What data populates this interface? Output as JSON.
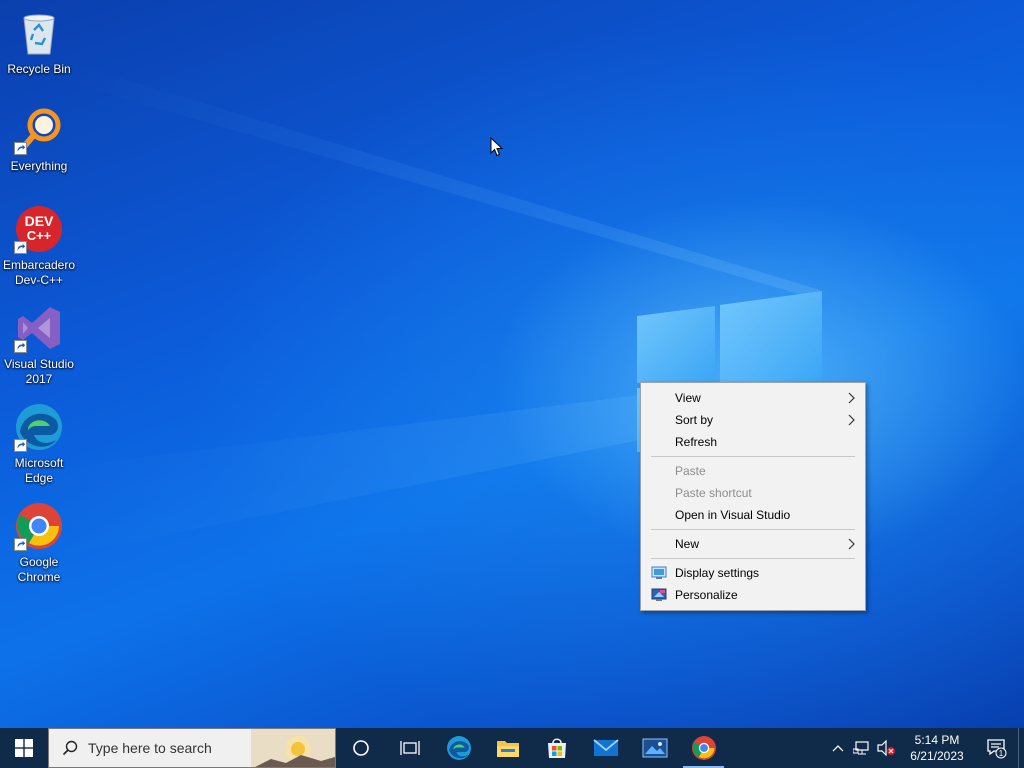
{
  "desktop_icons": [
    {
      "label": "Recycle Bin",
      "icon": "recycle-bin-icon",
      "shortcut": false
    },
    {
      "label": "Everything",
      "icon": "everything-search-icon",
      "shortcut": true
    },
    {
      "label": "Embarcadero\nDev-C++",
      "icon": "devcpp-icon",
      "icon_text": "DEV\nC++",
      "shortcut": true
    },
    {
      "label": "Visual Studio\n2017",
      "icon": "visual-studio-icon",
      "shortcut": true
    },
    {
      "label": "Microsoft\nEdge",
      "icon": "edge-icon",
      "shortcut": true
    },
    {
      "label": "Google\nChrome",
      "icon": "chrome-icon",
      "shortcut": true
    }
  ],
  "context_menu": {
    "items": [
      {
        "label": "View",
        "submenu": true,
        "disabled": false
      },
      {
        "label": "Sort by",
        "submenu": true,
        "disabled": false
      },
      {
        "label": "Refresh",
        "submenu": false,
        "disabled": false
      },
      {
        "separator": true
      },
      {
        "label": "Paste",
        "submenu": false,
        "disabled": true
      },
      {
        "label": "Paste shortcut",
        "submenu": false,
        "disabled": true
      },
      {
        "label": "Open in Visual Studio",
        "submenu": false,
        "disabled": false
      },
      {
        "separator": true
      },
      {
        "label": "New",
        "submenu": true,
        "disabled": false
      },
      {
        "separator": true
      },
      {
        "label": "Display settings",
        "submenu": false,
        "disabled": false,
        "icon": "display-settings-icon"
      },
      {
        "label": "Personalize",
        "submenu": false,
        "disabled": false,
        "icon": "personalize-icon"
      }
    ]
  },
  "taskbar": {
    "search_placeholder": "Type here to search",
    "pinned": [
      {
        "name": "cortana-icon",
        "active": false
      },
      {
        "name": "task-view-icon",
        "active": false
      },
      {
        "name": "edge-icon",
        "active": false
      },
      {
        "name": "file-explorer-icon",
        "active": false
      },
      {
        "name": "microsoft-store-icon",
        "active": false
      },
      {
        "name": "mail-icon",
        "active": false
      },
      {
        "name": "photos-icon",
        "active": false
      },
      {
        "name": "chrome-icon",
        "active": true
      }
    ],
    "tray_icons": [
      "chevron-up-icon",
      "network-icon",
      "volume-muted-icon"
    ],
    "clock_time": "5:14 PM",
    "clock_date": "6/21/2023",
    "notification_count": "1"
  },
  "colors": {
    "taskbar_bg": "#102a4a",
    "menu_bg": "#f2f2f2",
    "wallpaper_accent": "#0d72ea"
  }
}
